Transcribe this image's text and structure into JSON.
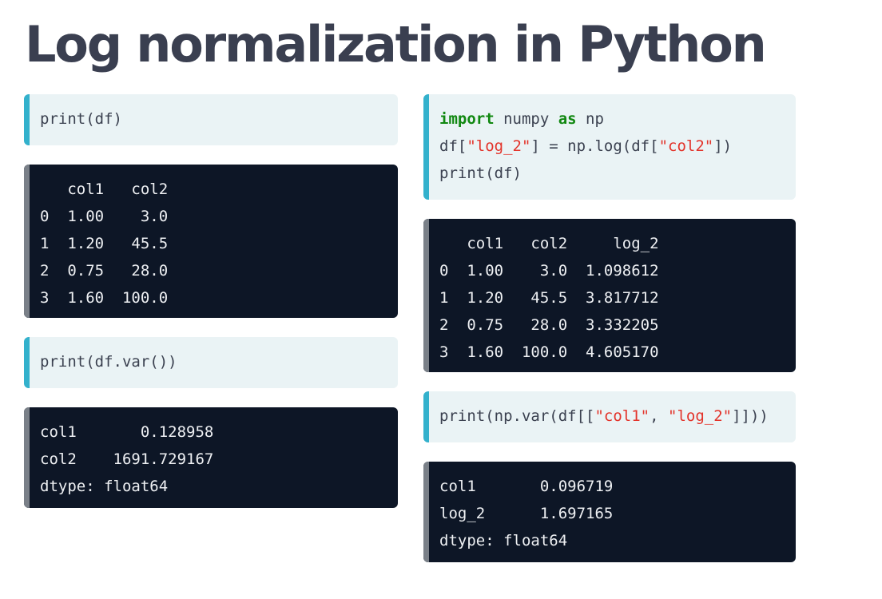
{
  "page": {
    "title": "Log normalization in Python"
  },
  "left": {
    "code1": {
      "line1": "print(df)"
    },
    "output1": {
      "header": "   col1   col2",
      "rows": [
        "0  1.00    3.0",
        "1  1.20   45.5",
        "2  0.75   28.0",
        "3  1.60  100.0"
      ]
    },
    "code2": {
      "line1": "print(df.var())"
    },
    "output2": {
      "rows": [
        "col1       0.128958",
        "col2    1691.729167",
        "dtype: float64"
      ]
    }
  },
  "right": {
    "code1": {
      "kw_import": "import",
      "t_numpy": " numpy ",
      "kw_as": "as",
      "t_np": " np",
      "l2_a": "df[",
      "l2_str1": "\"log_2\"",
      "l2_b": "] = np.log(df[",
      "l2_str2": "\"col2\"",
      "l2_c": "])",
      "line3": "print(df)"
    },
    "output1": {
      "header": "   col1   col2     log_2",
      "rows": [
        "0  1.00    3.0  1.098612",
        "1  1.20   45.5  3.817712",
        "2  0.75   28.0  3.332205",
        "3  1.60  100.0  4.605170"
      ]
    },
    "code2": {
      "a": "print(np.var(df[[",
      "str1": "\"col1\"",
      "b": ", ",
      "str2": "\"log_2\"",
      "c": "]]))"
    },
    "output2": {
      "rows": [
        "col1       0.096719",
        "log_2      1.697165",
        "dtype: float64"
      ]
    }
  }
}
